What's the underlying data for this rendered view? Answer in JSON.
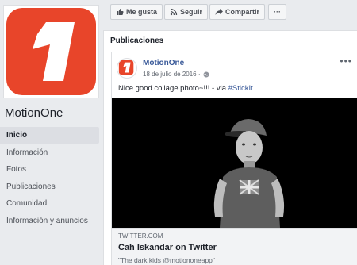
{
  "page": {
    "name": "MotionOne"
  },
  "nav": {
    "items": [
      {
        "label": "Inicio",
        "active": true
      },
      {
        "label": "Información",
        "active": false
      },
      {
        "label": "Fotos",
        "active": false
      },
      {
        "label": "Publicaciones",
        "active": false
      },
      {
        "label": "Comunidad",
        "active": false
      },
      {
        "label": "Información y anuncios",
        "active": false
      }
    ]
  },
  "actions": {
    "like_label": "Me gusta",
    "follow_label": "Seguir",
    "share_label": "Compartir",
    "more_label": "···"
  },
  "section": {
    "title": "Publicaciones"
  },
  "post": {
    "author": "MotionOne",
    "date": "18 de julio de 2016 ·",
    "menu": "•••",
    "text_prefix": "Nice good collage photo~!!! - via ",
    "hashtag": "#StickIt",
    "link": {
      "source": "TWITTER.COM",
      "title": "Cah Iskandar on Twitter",
      "description": "\"The dark kids @motiononeapp\""
    }
  },
  "colors": {
    "brand": "#e8452a",
    "link": "#385898",
    "background": "#e9ebee"
  }
}
